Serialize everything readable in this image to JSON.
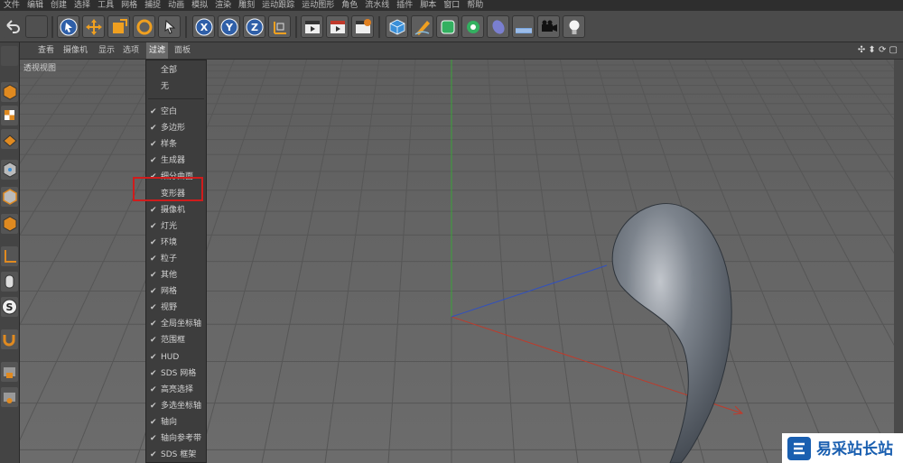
{
  "menubar": {
    "items": [
      "文件",
      "编辑",
      "创建",
      "选择",
      "工具",
      "网格",
      "捕捉",
      "动画",
      "模拟",
      "渲染",
      "雕刻",
      "运动跟踪",
      "运动图形",
      "角色",
      "流水线",
      "插件",
      "脚本",
      "窗口",
      "帮助"
    ]
  },
  "viewport_menu": {
    "items": [
      "查看",
      "摄像机",
      "显示",
      "选项",
      "过滤",
      "面板"
    ],
    "active": "过滤"
  },
  "viewport": {
    "label": "透视视图"
  },
  "filter_menu": {
    "top_items": [
      "全部",
      "无"
    ],
    "items": [
      {
        "label": "空白",
        "checked": true
      },
      {
        "label": "多边形",
        "checked": true
      },
      {
        "label": "样条",
        "checked": true
      },
      {
        "label": "生成器",
        "checked": true
      },
      {
        "label": "细分曲面",
        "checked": true
      },
      {
        "label": "变形器",
        "checked": false
      },
      {
        "label": "摄像机",
        "checked": true
      },
      {
        "label": "灯光",
        "checked": true
      },
      {
        "label": "环境",
        "checked": true
      },
      {
        "label": "粒子",
        "checked": true
      },
      {
        "label": "其他",
        "checked": true
      },
      {
        "label": "网格",
        "checked": true
      },
      {
        "label": "视野",
        "checked": true
      },
      {
        "label": "全局坐标轴",
        "checked": true
      },
      {
        "label": "范围框",
        "checked": true
      },
      {
        "label": "HUD",
        "checked": true
      },
      {
        "label": "SDS 网格",
        "checked": true
      },
      {
        "label": "高亮选择",
        "checked": true
      },
      {
        "label": "多选坐标轴",
        "checked": true
      },
      {
        "label": "轴向",
        "checked": true
      },
      {
        "label": "轴向参考带",
        "checked": true
      },
      {
        "label": "SDS 框架",
        "checked": true
      }
    ]
  },
  "toolbar": {
    "x_label": "X",
    "y_label": "Y",
    "z_label": "Z"
  },
  "watermark": {
    "title": "易采站长站"
  },
  "colors": {
    "highlight": "#d01c1c",
    "axis_x": "#c03a2a",
    "axis_y": "#3aa33a",
    "axis_z": "#3050c0"
  }
}
